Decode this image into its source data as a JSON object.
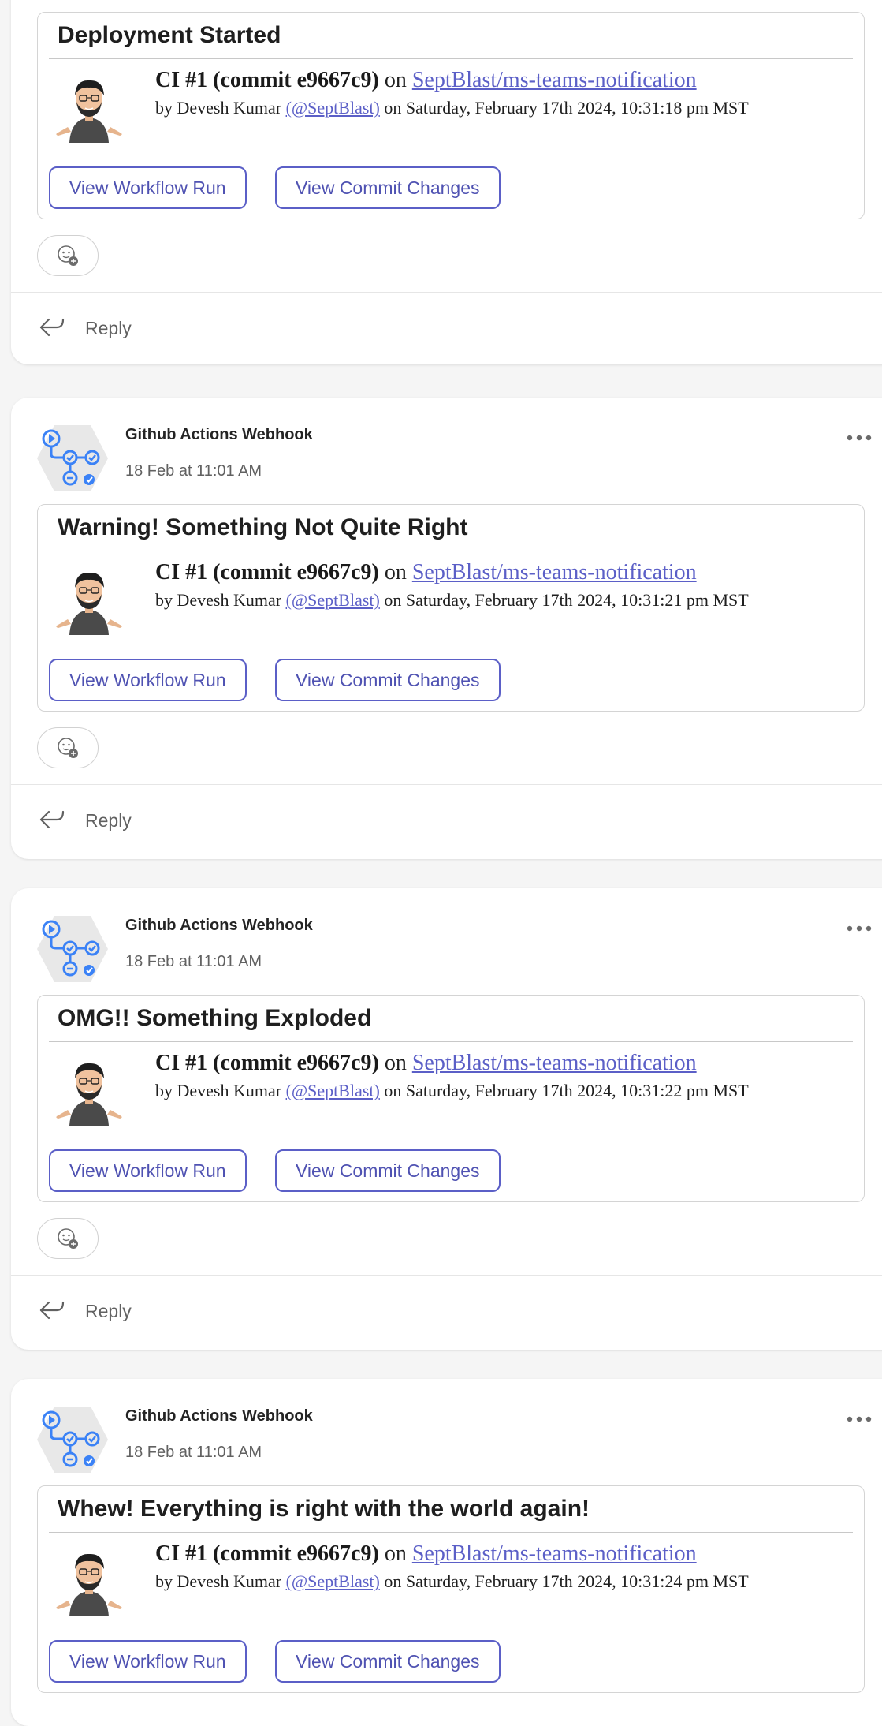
{
  "posts": [
    {
      "sender": "",
      "timestamp": "",
      "card": {
        "title": "Deployment Started",
        "ci_label": "CI #1 (commit e9667c9)",
        "on_text": "on",
        "repo_link": "SeptBlast/ms-teams-notification",
        "by_text": "by Devesh Kumar",
        "handle_link": "(@SeptBlast)",
        "date_text": "on Saturday, February 17th 2024, 10:31:18 pm MST",
        "workflow_button": "View Workflow Run",
        "commit_button": "View Commit Changes"
      },
      "reply_label": "Reply"
    },
    {
      "sender": "Github Actions Webhook",
      "timestamp": "18 Feb at 11:01 AM",
      "card": {
        "title": "Warning! Something Not Quite Right",
        "ci_label": "CI #1 (commit e9667c9)",
        "on_text": "on",
        "repo_link": "SeptBlast/ms-teams-notification",
        "by_text": "by Devesh Kumar",
        "handle_link": "(@SeptBlast)",
        "date_text": "on Saturday, February 17th 2024, 10:31:21 pm MST",
        "workflow_button": "View Workflow Run",
        "commit_button": "View Commit Changes"
      },
      "reply_label": "Reply"
    },
    {
      "sender": "Github Actions Webhook",
      "timestamp": "18 Feb at 11:01 AM",
      "card": {
        "title": "OMG!! Something Exploded",
        "ci_label": "CI #1 (commit e9667c9)",
        "on_text": "on",
        "repo_link": "SeptBlast/ms-teams-notification",
        "by_text": "by Devesh Kumar",
        "handle_link": "(@SeptBlast)",
        "date_text": "on Saturday, February 17th 2024, 10:31:22 pm MST",
        "workflow_button": "View Workflow Run",
        "commit_button": "View Commit Changes"
      },
      "reply_label": "Reply"
    },
    {
      "sender": "Github Actions Webhook",
      "timestamp": "18 Feb at 11:01 AM",
      "card": {
        "title": "Whew! Everything is right with the world again!",
        "ci_label": "CI #1 (commit e9667c9)",
        "on_text": "on",
        "repo_link": "SeptBlast/ms-teams-notification",
        "by_text": "by Devesh Kumar",
        "handle_link": "(@SeptBlast)",
        "date_text": "on Saturday, February 17th 2024, 10:31:24 pm MST",
        "workflow_button": "View Workflow Run",
        "commit_button": "View Commit Changes"
      },
      "reply_label": ""
    }
  ],
  "icons": {
    "bot_avatar": "github-actions-webhook-icon",
    "person_avatar": "cartoon-person-avatar",
    "reaction": "add-reaction-icon",
    "reply": "reply-arrow-icon",
    "more": "more-options-icon"
  },
  "colors": {
    "accent": "#5b5fc7",
    "bot_blue": "#3b82f6",
    "text_muted": "#616161"
  }
}
